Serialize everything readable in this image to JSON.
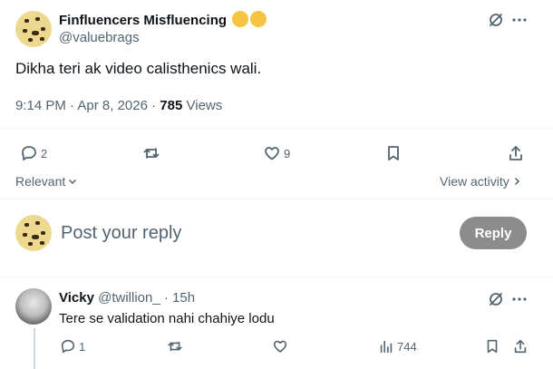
{
  "tweet": {
    "display_name": "Finfluencers Misfluencing",
    "handle": "@valuebrags",
    "text": "Dikha teri ak video calisthenics wali.",
    "time": "9:14 PM",
    "sep": "·",
    "date": "Apr 8, 2026",
    "views_count": "785",
    "views_label": "Views",
    "reply_count": "2",
    "like_count": "9"
  },
  "sort": {
    "label": "Relevant",
    "view_activity": "View activity"
  },
  "composer": {
    "placeholder": "Post your reply",
    "button": "Reply"
  },
  "reply": {
    "display_name": "Vicky",
    "handle": "@twillion_",
    "sep": "·",
    "age": "15h",
    "text": "Tere se validation nahi chahiye lodu",
    "reply_count": "1",
    "views_count": "744"
  },
  "icons": [
    "grok-icon",
    "more-icon",
    "reply-icon",
    "retweet-icon",
    "like-icon",
    "bookmark-icon",
    "share-icon",
    "chevron-down-icon",
    "chevron-right-icon",
    "analytics-icon"
  ]
}
